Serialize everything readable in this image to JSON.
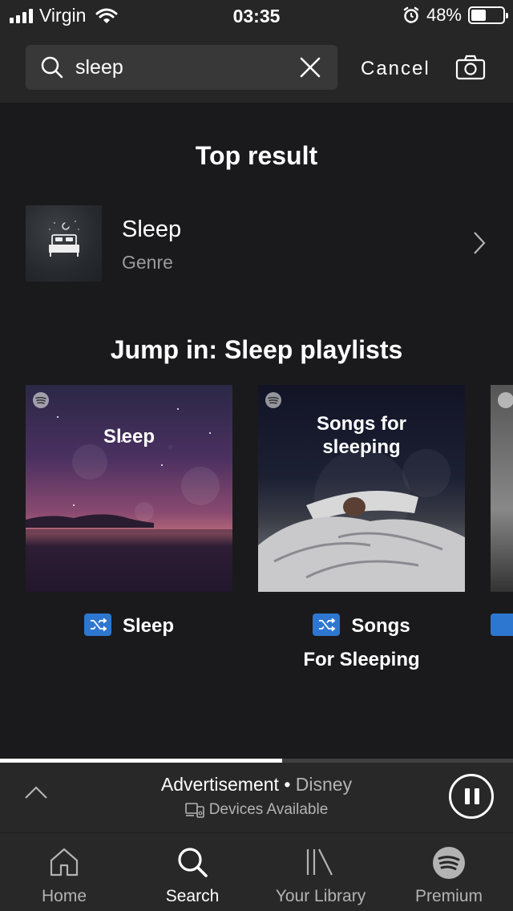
{
  "status_bar": {
    "carrier": "Virgin",
    "time": "03:35",
    "battery": "48%",
    "battery_level": 0.48
  },
  "search": {
    "query": "sleep",
    "cancel_label": "Cancel"
  },
  "top_result": {
    "heading": "Top result",
    "name": "Sleep",
    "type": "Genre"
  },
  "playlists": {
    "heading": "Jump in: Sleep playlists",
    "items": [
      {
        "art_text": "Sleep",
        "label": "Sleep"
      },
      {
        "art_text_line1": "Songs for",
        "art_text_line2": "sleeping",
        "label_line1": "Songs",
        "label_line2": "For Sleeping"
      }
    ]
  },
  "now_playing": {
    "title": "Advertisement",
    "separator": "•",
    "artist": "Disney",
    "devices": "Devices Available",
    "progress": 0.55
  },
  "nav": {
    "items": [
      {
        "label": "Home",
        "icon": "home-icon"
      },
      {
        "label": "Search",
        "icon": "search-icon",
        "active": true
      },
      {
        "label": "Your Library",
        "icon": "library-icon"
      },
      {
        "label": "Premium",
        "icon": "spotify-logo-icon"
      }
    ]
  },
  "colors": {
    "background": "#181818",
    "header": "#262626",
    "accent_blue": "#2e77d0",
    "muted_text": "#b3b3b3"
  }
}
